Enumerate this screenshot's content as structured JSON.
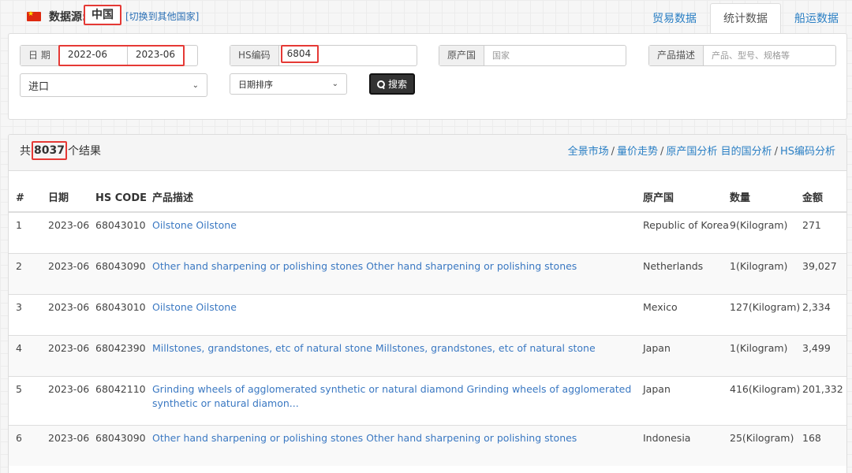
{
  "header": {
    "source_label": "数据源:",
    "source_country": "中国",
    "switch_link": "[切换到其他国家]",
    "tabs": [
      {
        "label": "贸易数据",
        "active": false
      },
      {
        "label": "统计数据",
        "active": true
      },
      {
        "label": "船运数据",
        "active": false
      }
    ]
  },
  "filters": {
    "date_label": "日 期",
    "date_from": "2022-06",
    "date_to": "2023-06",
    "hs_label": "HS编码",
    "hs_value": "6804",
    "origin_label": "原产国",
    "origin_placeholder": "国家",
    "desc_label": "产品描述",
    "desc_placeholder": "产品、型号、规格等",
    "trade_type": "进口",
    "sort": "日期排序",
    "search_button": "搜索"
  },
  "results": {
    "count_prefix": "共",
    "count": "8037",
    "count_suffix": "个结果",
    "links": [
      "全景市场",
      "量价走势",
      "原产国分析",
      "目的国分析",
      "HS编码分析"
    ],
    "columns": [
      "#",
      "日期",
      "HS CODE",
      "产品描述",
      "原产国",
      "数量",
      "金额"
    ],
    "rows": [
      {
        "idx": "1",
        "date": "2023-06",
        "hs": "68043010",
        "desc": "Oilstone Oilstone",
        "origin": "Republic of Korea",
        "qty": "9(Kilogram)",
        "amount": "271"
      },
      {
        "idx": "2",
        "date": "2023-06",
        "hs": "68043090",
        "desc": "Other hand sharpening or polishing stones Other hand sharpening or polishing stones",
        "origin": "Netherlands",
        "qty": "1(Kilogram)",
        "amount": "39,027"
      },
      {
        "idx": "3",
        "date": "2023-06",
        "hs": "68043010",
        "desc": "Oilstone Oilstone",
        "origin": "Mexico",
        "qty": "127(Kilogram)",
        "amount": "2,334"
      },
      {
        "idx": "4",
        "date": "2023-06",
        "hs": "68042390",
        "desc": "Millstones, grandstones, etc of natural stone Millstones, grandstones, etc of natural stone",
        "origin": "Japan",
        "qty": "1(Kilogram)",
        "amount": "3,499"
      },
      {
        "idx": "5",
        "date": "2023-06",
        "hs": "68042110",
        "desc": "Grinding wheels of agglomerated synthetic or natural diamond Grinding wheels of agglomerated synthetic or natural diamon...",
        "origin": "Japan",
        "qty": "416(Kilogram)",
        "amount": "201,332"
      },
      {
        "idx": "6",
        "date": "2023-06",
        "hs": "68043090",
        "desc": "Other hand sharpening or polishing stones Other hand sharpening or polishing stones",
        "origin": "Indonesia",
        "qty": "25(Kilogram)",
        "amount": "168"
      }
    ]
  }
}
